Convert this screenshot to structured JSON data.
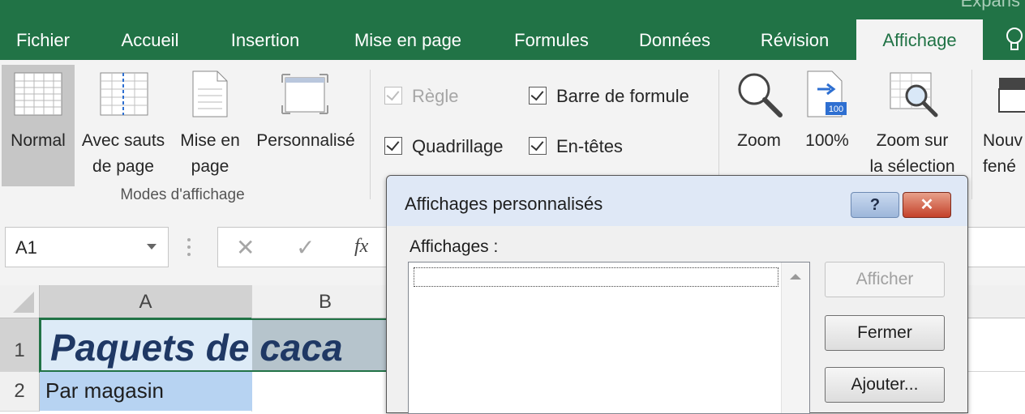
{
  "window": {
    "title_partial": "Expans"
  },
  "tabs": [
    {
      "label": "Fichier",
      "active": false
    },
    {
      "label": "Accueil",
      "active": false
    },
    {
      "label": "Insertion",
      "active": false
    },
    {
      "label": "Mise en page",
      "active": false
    },
    {
      "label": "Formules",
      "active": false
    },
    {
      "label": "Données",
      "active": false
    },
    {
      "label": "Révision",
      "active": false
    },
    {
      "label": "Affichage",
      "active": true
    }
  ],
  "ribbon": {
    "views_group": {
      "label": "Modes d'affichage",
      "buttons": [
        {
          "line1": "Normal",
          "line2": "",
          "selected": true
        },
        {
          "line1": "Avec sauts",
          "line2": "de page",
          "selected": false
        },
        {
          "line1": "Mise en",
          "line2": "page",
          "selected": false
        },
        {
          "line1": "Personnalisé",
          "line2": "",
          "selected": false
        }
      ]
    },
    "show_group": {
      "regle": {
        "label": "Règle",
        "checked": true,
        "disabled": true
      },
      "barre_formule": {
        "label": "Barre de formule",
        "checked": true
      },
      "quadrillage": {
        "label": "Quadrillage",
        "checked": true
      },
      "en_tetes": {
        "label": "En-têtes",
        "checked": true
      }
    },
    "zoom_group": {
      "zoom": {
        "label": "Zoom"
      },
      "hundred": {
        "label": "100%",
        "badge": "100"
      },
      "zoom_sel": {
        "line1": "Zoom sur",
        "line2": "la sélection"
      }
    },
    "window_group": {
      "new_window": {
        "line1": "Nouv",
        "line2": "fené"
      }
    }
  },
  "formula_bar": {
    "name_box": "A1",
    "fx": "fx"
  },
  "sheet": {
    "columns": [
      "A",
      "B"
    ],
    "rows": [
      {
        "number": "1",
        "cell_a": "Paquets de caca"
      },
      {
        "number": "2",
        "cell_a": "Par magasin"
      }
    ]
  },
  "dialog": {
    "title": "Affichages personnalisés",
    "help_label": "?",
    "list_label": "Affichages :",
    "buttons": {
      "show": {
        "label": "Afficher",
        "disabled": true
      },
      "close": {
        "label": "Fermer"
      },
      "add": {
        "label": "Ajouter..."
      }
    }
  },
  "colors": {
    "excel_green": "#217346",
    "selected_cell_fill": "#b7d3f2",
    "title_text_color": "#1f3864"
  }
}
